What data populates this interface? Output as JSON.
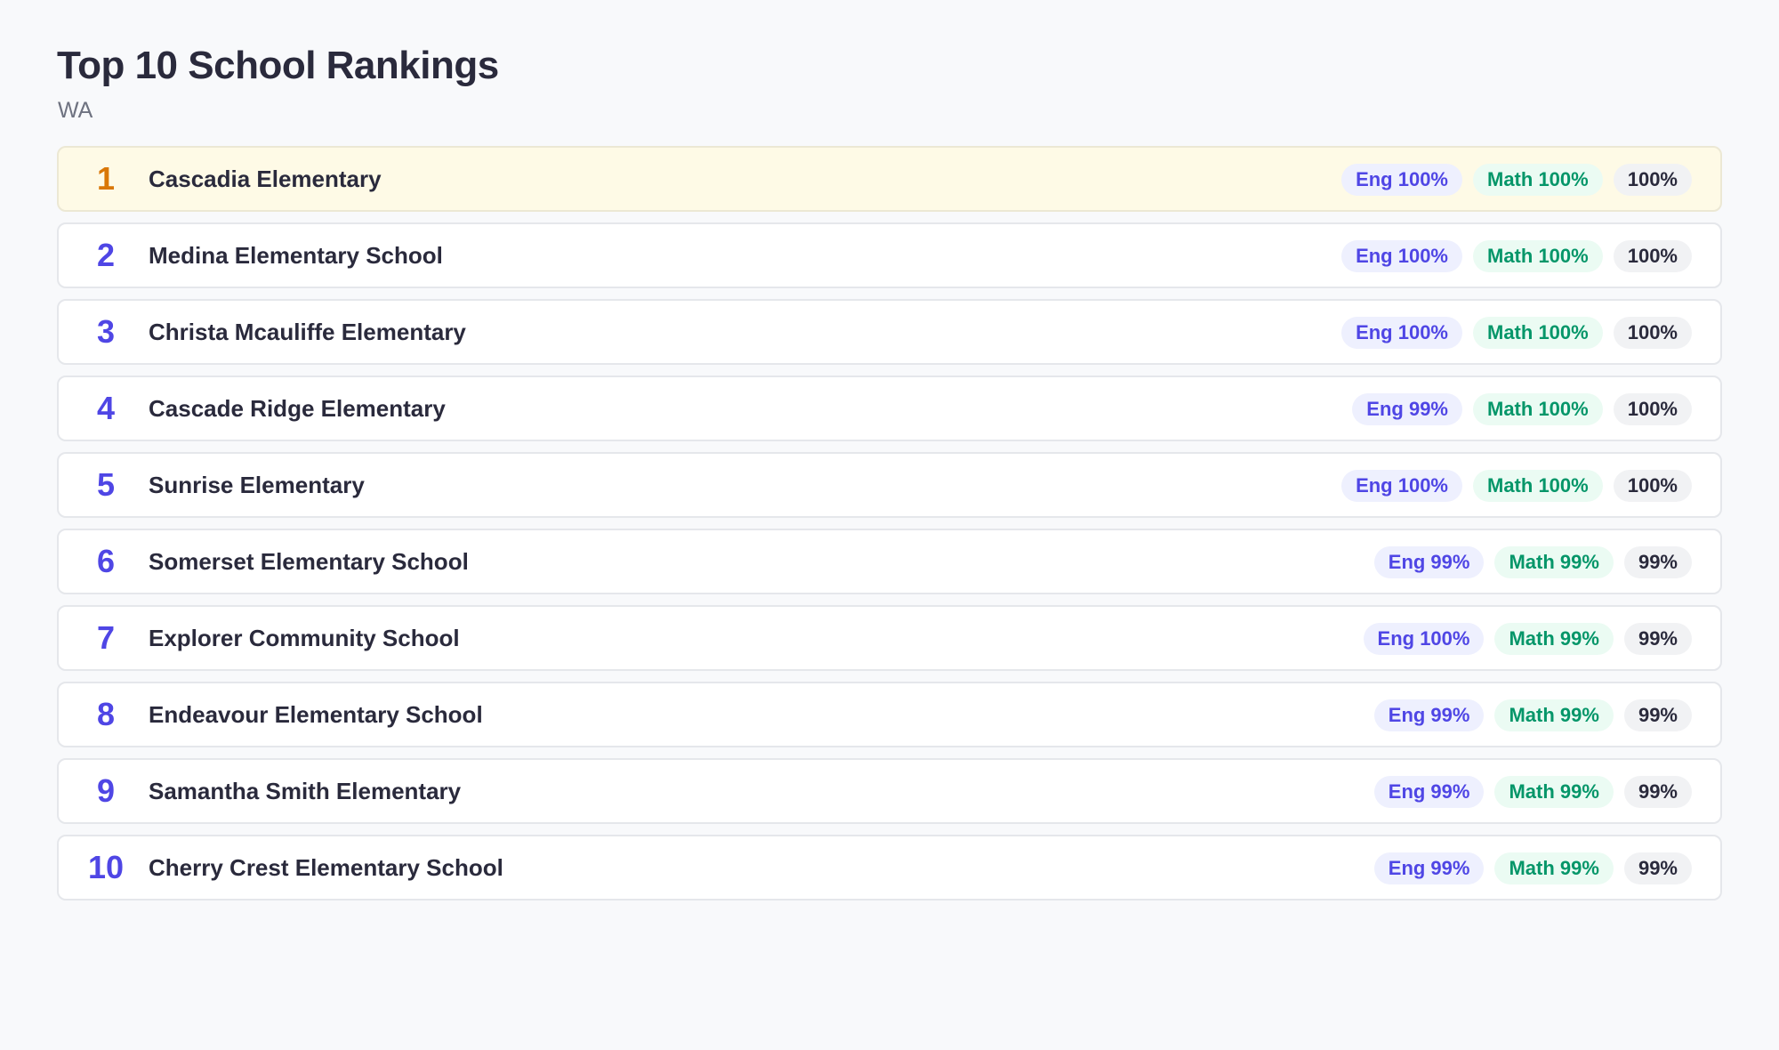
{
  "header": {
    "title": "Top 10 School Rankings",
    "subtitle": "WA"
  },
  "colors": {
    "accent": "#4f46e5",
    "top_rank": "#d97706",
    "math": "#059669",
    "top_row_bg": "#fefae6"
  },
  "rankings": [
    {
      "rank": "1",
      "name": "Cascadia Elementary",
      "eng": "Eng 100%",
      "math": "Math 100%",
      "overall": "100%"
    },
    {
      "rank": "2",
      "name": "Medina Elementary School",
      "eng": "Eng 100%",
      "math": "Math 100%",
      "overall": "100%"
    },
    {
      "rank": "3",
      "name": "Christa Mcauliffe Elementary",
      "eng": "Eng 100%",
      "math": "Math 100%",
      "overall": "100%"
    },
    {
      "rank": "4",
      "name": "Cascade Ridge Elementary",
      "eng": "Eng 99%",
      "math": "Math 100%",
      "overall": "100%"
    },
    {
      "rank": "5",
      "name": "Sunrise Elementary",
      "eng": "Eng 100%",
      "math": "Math 100%",
      "overall": "100%"
    },
    {
      "rank": "6",
      "name": "Somerset Elementary School",
      "eng": "Eng 99%",
      "math": "Math 99%",
      "overall": "99%"
    },
    {
      "rank": "7",
      "name": "Explorer Community School",
      "eng": "Eng 100%",
      "math": "Math 99%",
      "overall": "99%"
    },
    {
      "rank": "8",
      "name": "Endeavour Elementary School",
      "eng": "Eng 99%",
      "math": "Math 99%",
      "overall": "99%"
    },
    {
      "rank": "9",
      "name": "Samantha Smith Elementary",
      "eng": "Eng 99%",
      "math": "Math 99%",
      "overall": "99%"
    },
    {
      "rank": "10",
      "name": "Cherry Crest Elementary School",
      "eng": "Eng 99%",
      "math": "Math 99%",
      "overall": "99%"
    }
  ]
}
